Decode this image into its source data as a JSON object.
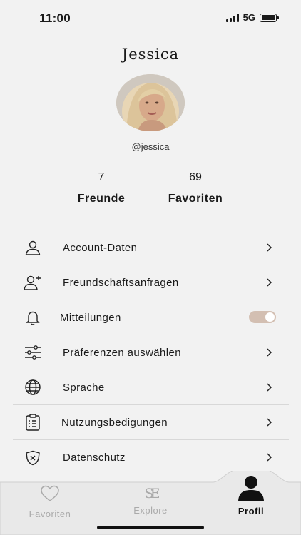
{
  "status": {
    "time": "11:00",
    "network": "5G"
  },
  "profile": {
    "name": "Jessica",
    "username": "@jessica",
    "avatar_icon": "profile-photo"
  },
  "stats": [
    {
      "value": "7",
      "label": "Freunde"
    },
    {
      "value": "69",
      "label": "Favoriten"
    }
  ],
  "menu": {
    "items": [
      {
        "label": "Account-Daten",
        "icon": "user-icon"
      },
      {
        "label": "Freundschaftsanfragen",
        "icon": "add-user-icon"
      },
      {
        "label": "Mitteilungen",
        "icon": "bell-icon",
        "toggle_on": true
      },
      {
        "label": "Präferenzen auswählen",
        "icon": "sliders-icon"
      },
      {
        "label": "Sprache",
        "icon": "globe-icon"
      },
      {
        "label": "Nutzungsbedigungen",
        "icon": "clipboard-icon"
      },
      {
        "label": "Datenschutz",
        "icon": "shield-icon"
      }
    ]
  },
  "tabbar": {
    "tabs": [
      {
        "label": "Favoriten",
        "icon": "heart-icon",
        "active": false
      },
      {
        "label": "Explore",
        "icon": "logo-icon",
        "logo_text": "SE",
        "active": false
      },
      {
        "label": "Profil",
        "icon": "profile-icon",
        "active": true
      }
    ]
  },
  "colors": {
    "background": "#f2f2f2",
    "toggle_track": "#d3bfb2",
    "inactive_tab": "#aaaaaa",
    "active_tab": "#111111"
  }
}
